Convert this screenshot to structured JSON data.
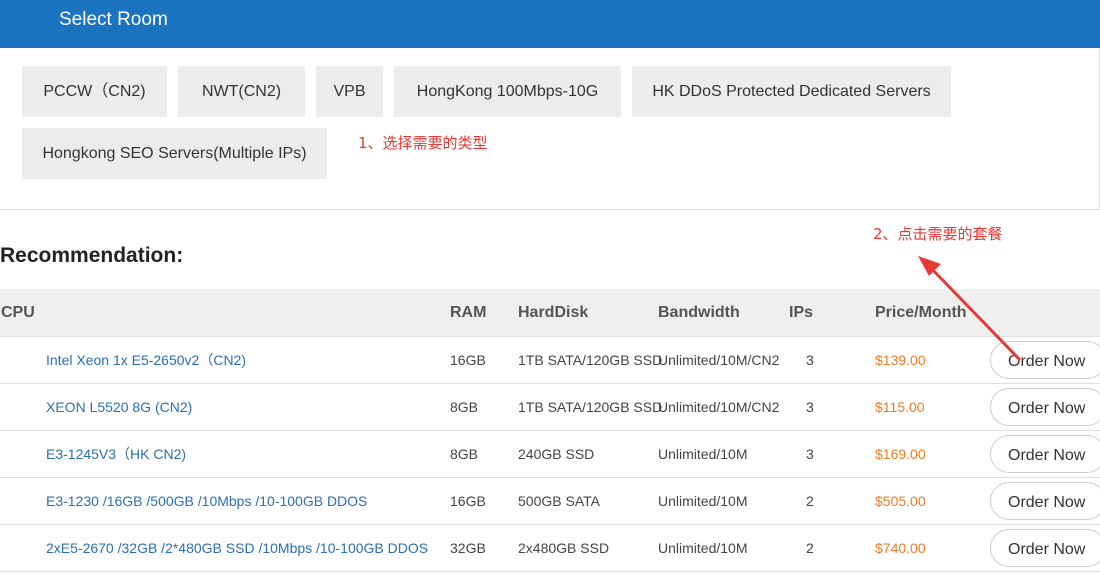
{
  "header": {
    "title": "Select Room"
  },
  "rooms": [
    {
      "label": "PCCW（CN2)"
    },
    {
      "label": "NWT(CN2)"
    },
    {
      "label": "VPB"
    },
    {
      "label": "HongKong 100Mbps-10G"
    },
    {
      "label": "HK DDoS Protected Dedicated Servers"
    },
    {
      "label": "Hongkong SEO Servers(Multiple IPs)"
    }
  ],
  "annotations": {
    "step1": "1、选择需要的类型",
    "step2": "2、点击需要的套餐",
    "color": "#e53935"
  },
  "recommendation": {
    "title": "Recommendation:",
    "headers": {
      "cpu": "CPU",
      "ram": "RAM",
      "harddisk": "HardDisk",
      "bandwidth": "Bandwidth",
      "ips": "IPs",
      "price": "Price/Month"
    },
    "order_label": "Order Now",
    "rows": [
      {
        "cpu": "Intel Xeon 1x E5-2650v2（CN2)",
        "ram": "16GB",
        "harddisk": "1TB SATA/120GB SSD",
        "bandwidth": "Unlimited/10M/CN2",
        "ips": "3",
        "price": "$139.00"
      },
      {
        "cpu": "XEON L5520 8G (CN2)",
        "ram": "8GB",
        "harddisk": "1TB SATA/120GB SSD",
        "bandwidth": "Unlimited/10M/CN2",
        "ips": "3",
        "price": "$115.00"
      },
      {
        "cpu": "E3-1245V3（HK CN2)",
        "ram": "8GB",
        "harddisk": "240GB SSD",
        "bandwidth": "Unlimited/10M",
        "ips": "3",
        "price": "$169.00"
      },
      {
        "cpu": "E3-1230 /16GB /500GB /10Mbps /10-100GB DDOS",
        "ram": "16GB",
        "harddisk": "500GB SATA",
        "bandwidth": "Unlimited/10M",
        "ips": "2",
        "price": "$505.00"
      },
      {
        "cpu": "2xE5-2670 /32GB /2*480GB SSD /10Mbps /10-100GB DDOS",
        "ram": "32GB",
        "harddisk": "2x480GB SSD",
        "bandwidth": "Unlimited/10M",
        "ips": "2",
        "price": "$740.00"
      }
    ]
  },
  "colors": {
    "header_bg": "#1c74c0",
    "link": "#2b6fb0",
    "price": "#f07b22",
    "button_bg": "#ececec"
  }
}
